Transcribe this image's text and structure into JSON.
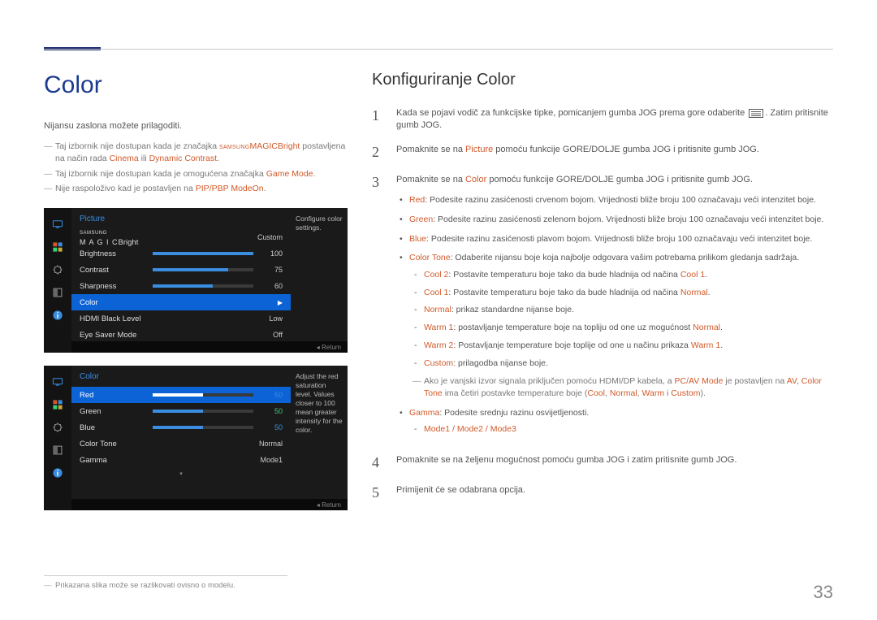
{
  "left": {
    "title": "Color",
    "intro": "Nijansu zaslona možete prilagoditi.",
    "notes": [
      {
        "pre": "Taj izbornik nije dostupan kada je značajka ",
        "magic": "MAGIC",
        "magicSuffix": "Bright",
        "post": " postavljena na način rada ",
        "r1": "Cinema",
        "mid": " ili ",
        "r2": "Dynamic Contrast",
        "end": "."
      },
      {
        "pre": "Taj izbornik nije dostupan kada je omogućena značajka ",
        "r1": "Game Mode",
        "end": "."
      },
      {
        "pre": "Nije raspoloživo kad je ",
        "r1": "PIP/PBP Mode",
        "post": " postavljen na ",
        "r2": "On",
        "end": "."
      }
    ],
    "osd1": {
      "title": "Picture",
      "desc": "Configure color settings.",
      "rows": [
        {
          "label": "MAGICBright",
          "valtext": "Custom",
          "magic": true
        },
        {
          "label": "Brightness",
          "bar": 100,
          "val": "100"
        },
        {
          "label": "Contrast",
          "bar": 75,
          "val": "75"
        },
        {
          "label": "Sharpness",
          "bar": 60,
          "val": "60"
        },
        {
          "label": "Color",
          "sel": true,
          "arrow": true
        },
        {
          "label": "HDMI Black Level",
          "valtext": "Low"
        },
        {
          "label": "Eye Saver Mode",
          "valtext": "Off"
        }
      ],
      "return": "Return"
    },
    "osd2": {
      "title": "Color",
      "desc": "Adjust the red saturation level. Values closer to 100 mean greater intensity for the color.",
      "rows": [
        {
          "label": "Red",
          "bar": 50,
          "sel": true,
          "val": "50",
          "vclass": "blue"
        },
        {
          "label": "Green",
          "bar": 50,
          "val": "50",
          "vclass": "grn"
        },
        {
          "label": "Blue",
          "bar": 50,
          "val": "50",
          "vclass": "blue"
        },
        {
          "label": "Color Tone",
          "valtext": "Normal"
        },
        {
          "label": "Gamma",
          "valtext": "Mode1"
        }
      ],
      "return": "Return"
    },
    "footnote": "Prikazana slika može se razlikovati ovisno o modelu."
  },
  "right": {
    "title": "Konfiguriranje Color",
    "steps": [
      {
        "n": "1",
        "t": [
          "Kada se pojavi vodič za funkcijske tipke, pomicanjem gumba JOG prema gore odaberite ",
          "[MENU]",
          ". Zatim pritisnite gumb JOG."
        ]
      },
      {
        "n": "2",
        "t": [
          "Pomaknite se na ",
          {
            "r": "Picture"
          },
          " pomoću funkcije GORE/DOLJE gumba JOG i pritisnite gumb JOG."
        ]
      },
      {
        "n": "3",
        "t": [
          "Pomaknite se na ",
          {
            "r": "Color"
          },
          " pomoću funkcije GORE/DOLJE gumba JOG i pritisnite gumb JOG."
        ]
      },
      {
        "n": "4",
        "t": [
          "Pomaknite se na željenu mogućnost pomoću gumba JOG i zatim pritisnite gumb JOG."
        ]
      },
      {
        "n": "5",
        "t": [
          "Primijenit će se odabrana opcija."
        ]
      }
    ],
    "bullets": [
      {
        "lead": "Red",
        "text": ": Podesite razinu zasićenosti crvenom bojom. Vrijednosti bliže broju 100 označavaju veći intenzitet boje."
      },
      {
        "lead": "Green",
        "text": ": Podesite razinu zasićenosti zelenom bojom. Vrijednosti bliže broju 100 označavaju veći intenzitet boje."
      },
      {
        "lead": "Blue",
        "text": ": Podesite razinu zasićenosti plavom bojom. Vrijednosti bliže broju 100 označavaju veći intenzitet boje."
      },
      {
        "lead": "Color Tone",
        "text": ": Odaberite nijansu boje koja najbolje odgovara vašim potrebama prilikom gledanja sadržaja.",
        "sub": [
          {
            "l": "Cool 2",
            "t": ": Postavite temperaturu boje tako da bude hladnija od načina ",
            "r": "Cool 1",
            "end": "."
          },
          {
            "l": "Cool 1",
            "t": ": Postavite temperaturu boje tako da bude hladnija od načina ",
            "r": "Normal",
            "end": "."
          },
          {
            "l": "Normal",
            "t": ": prikaz standardne nijanse boje."
          },
          {
            "l": "Warm 1",
            "t": ": postavljanje temperature boje na topliju od one uz mogućnost ",
            "r": "Normal",
            "end": "."
          },
          {
            "l": "Warm 2",
            "t": ": Postavljanje temperature boje toplije od one u načinu prikaza ",
            "r": "Warm 1",
            "end": "."
          },
          {
            "l": "Custom",
            "t": ": prilagodba nijanse boje."
          }
        ],
        "note": {
          "pre": "Ako je vanjski izvor signala priključen pomoću HDMI/DP kabela, a ",
          "r1": "PC/AV Mode",
          "mid": " je postavljen na ",
          "r2": "AV",
          "mid2": ", ",
          "r3": "Color Tone",
          "post": " ima četiri postavke temperature boje (",
          "r4": "Cool",
          "c1": ", ",
          "r5": "Normal",
          "c2": ", ",
          "r6": "Warm",
          "c3": " i ",
          "r7": "Custom",
          "end": ")."
        }
      },
      {
        "lead": "Gamma",
        "text": ": Podesite srednju razinu osvijetljenosti.",
        "sub2": {
          "l": "Mode1 / Mode2 / Mode3"
        }
      }
    ]
  },
  "pageNumber": "33"
}
